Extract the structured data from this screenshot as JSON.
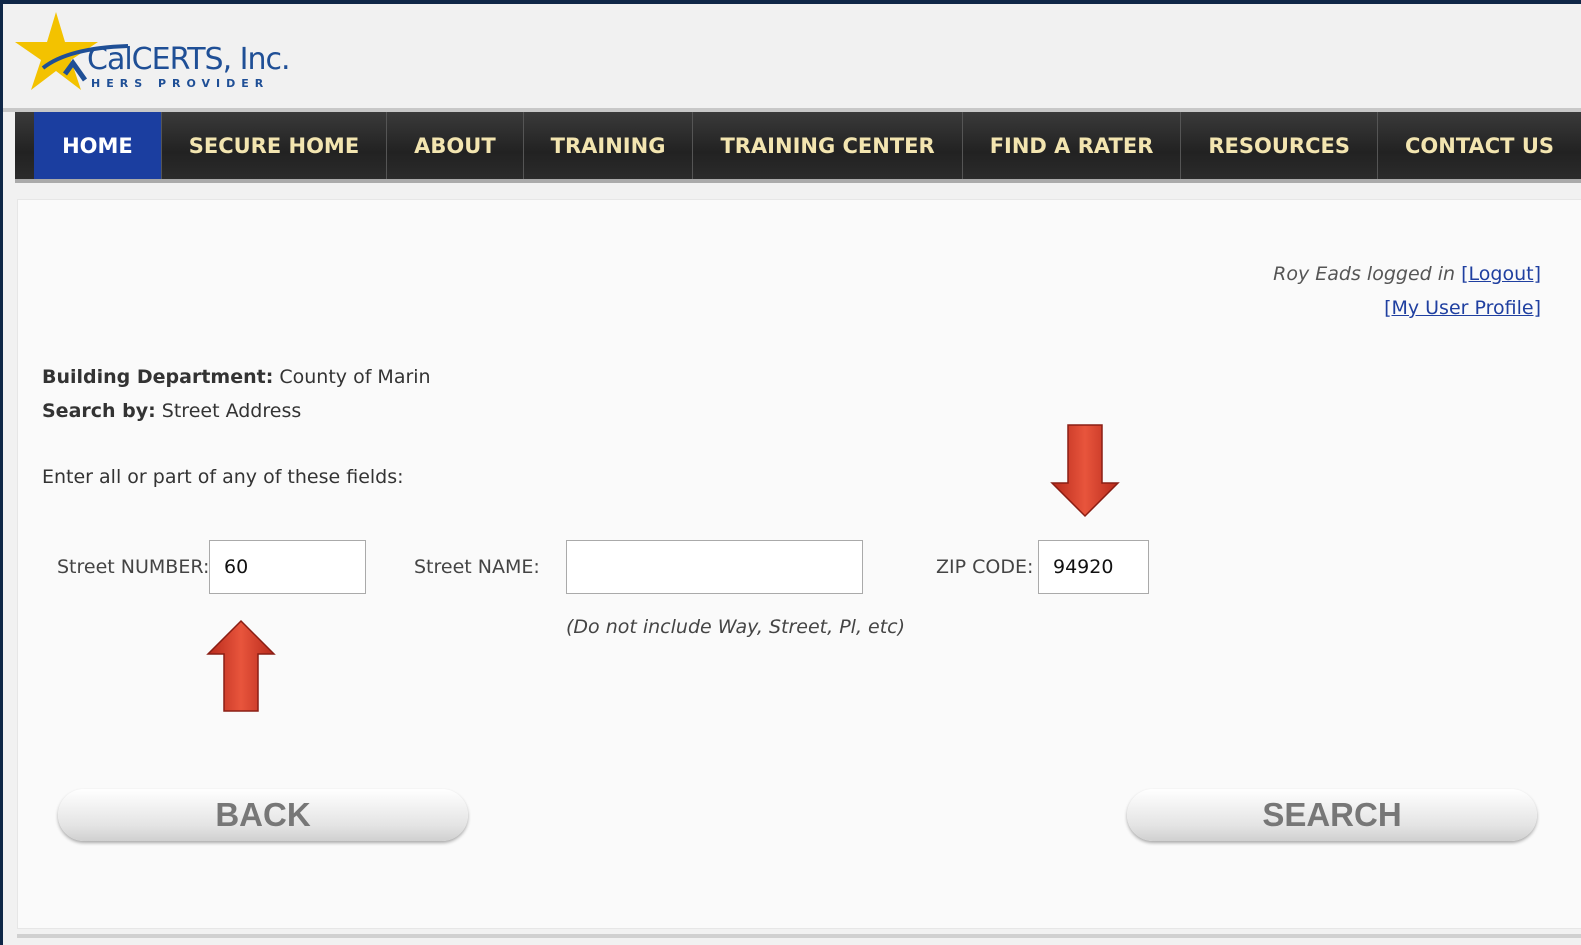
{
  "brand": {
    "name": "CalCERTS, Inc.",
    "tagline": "HERS PROVIDER",
    "colors": {
      "accent": "#1b3ea0",
      "nav_text": "#f3e5b0",
      "star": "#f3c200",
      "arrow": "#d6402c"
    }
  },
  "nav": {
    "items": [
      {
        "label": "HOME",
        "active": true
      },
      {
        "label": "SECURE HOME"
      },
      {
        "label": "ABOUT"
      },
      {
        "label": "TRAINING"
      },
      {
        "label": "TRAINING CENTER"
      },
      {
        "label": "FIND A RATER"
      },
      {
        "label": "RESOURCES"
      },
      {
        "label": "CONTACT US"
      }
    ]
  },
  "session": {
    "logged_in_text": "Roy Eads logged in",
    "logout_label": "[Logout]",
    "profile_label": "[My User Profile]"
  },
  "info": {
    "building_department_label": "Building Department:",
    "building_department_value": "County of Marin",
    "search_by_label": "Search by:",
    "search_by_value": "Street Address",
    "instructions": "Enter all or part of any of these fields:"
  },
  "form": {
    "street_number": {
      "label": "Street NUMBER:",
      "value": "60"
    },
    "street_name": {
      "label": "Street NAME:",
      "value": "",
      "note": "(Do not include Way, Street, Pl, etc)"
    },
    "zip_code": {
      "label": "ZIP CODE:",
      "value": "94920"
    }
  },
  "buttons": {
    "back_label": "BACK",
    "search_label": "SEARCH"
  },
  "annotations": {
    "arrow_icon_up": "arrow-up-icon",
    "arrow_icon_down": "arrow-down-icon"
  }
}
